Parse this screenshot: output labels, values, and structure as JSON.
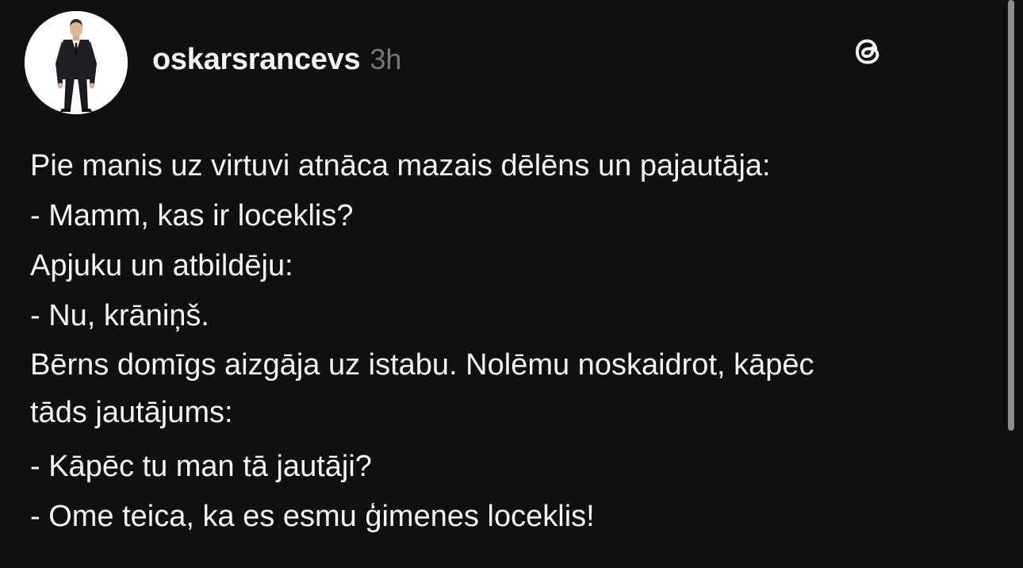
{
  "post": {
    "username": "oskarsrancevs",
    "timestamp": "3h",
    "lines": [
      "Pie manis uz virtuvi atnāca mazais dēlēns un pajautāja:",
      "- Mamm, kas ir loceklis?",
      "Apjuku un atbildēju:",
      "- Nu, krāniņš.",
      "Bērns domīgs aizgāja uz istabu. Nolēmu noskaidrot, kāpēc",
      "tāds jautājums:",
      "- Kāpēc tu man tā jautāji?",
      "- Ome teica, ka es esmu ģimenes loceklis!"
    ]
  },
  "icons": {
    "avatar": "profile-photo-man-in-suit",
    "logo": "threads-logo-icon"
  },
  "colors": {
    "background": "#101010",
    "text": "#f3f5f7",
    "muted": "#777777",
    "scrollbar": "#8e8e8e"
  }
}
